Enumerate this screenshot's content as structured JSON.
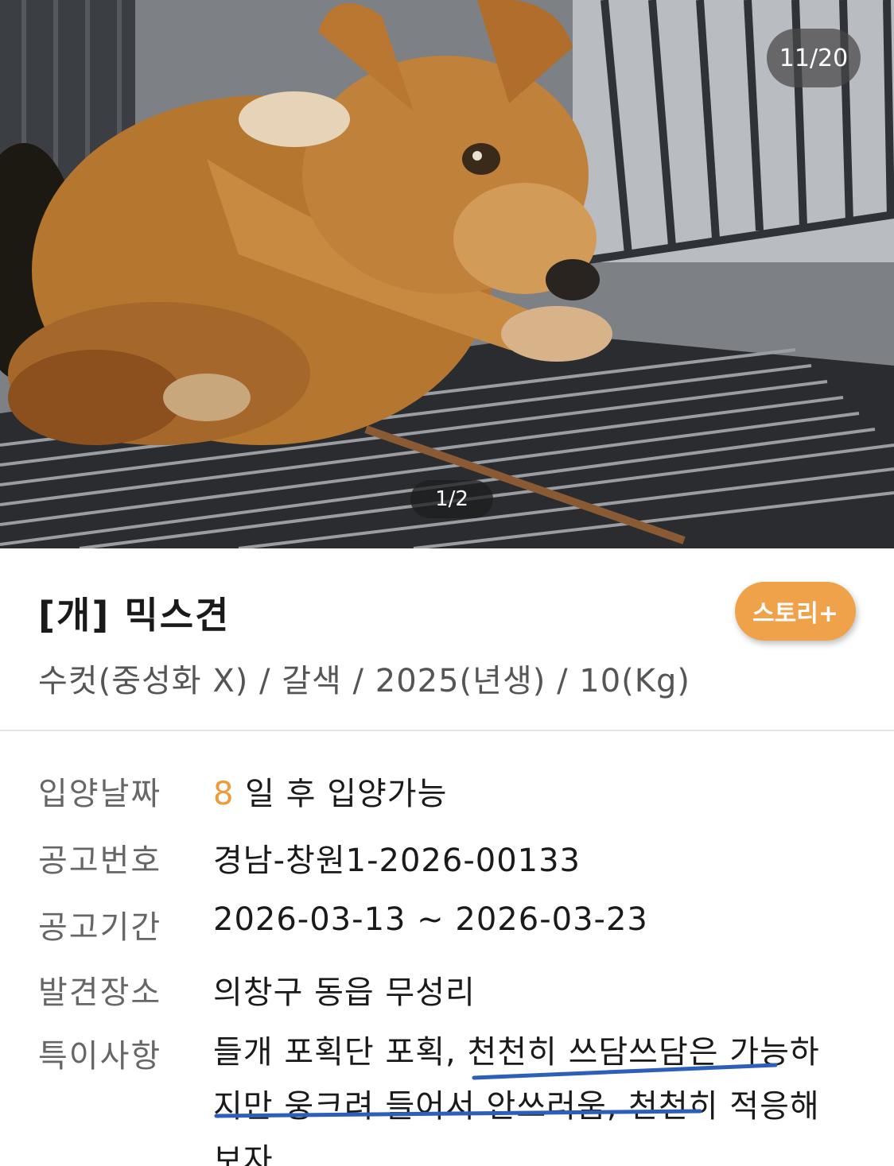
{
  "gallery": {
    "counter": "11/20",
    "inner_counter": "1/2",
    "photo_icon": "dog-photo"
  },
  "animal": {
    "title": "[개] 믹스견",
    "subtitle": "수컷(중성화 X) / 갈색 / 2025(년생) / 10(Kg)",
    "story_button": "스토리+"
  },
  "details": [
    {
      "label": "입양날짜",
      "value_num": "8",
      "value_text": " 일 후 입양가능"
    },
    {
      "label": "공고번호",
      "value": "경남-창원1-2026-00133"
    },
    {
      "label": "공고기간",
      "value": "2026-03-13 ~ 2026-03-23"
    },
    {
      "label": "발견장소",
      "value": "의창구 동읍 무성리"
    },
    {
      "label": "특이사항",
      "value": "들개 포획단 포획, 천천히 쓰담쓰담은 가능하지만 웅크려 들어서 안쓰러움, 천천히 적응해보자"
    }
  ],
  "colors": {
    "accent": "#ef9a3a",
    "story_button_bg": "#f0a24a",
    "underline": "#2e5fb8"
  }
}
